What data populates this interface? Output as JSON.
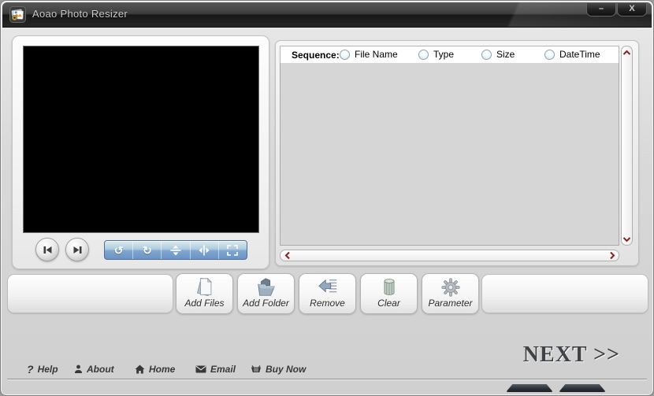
{
  "window": {
    "title": "Aoao Photo Resizer",
    "minimize_glyph": "–",
    "close_glyph": "X"
  },
  "preview": {
    "rotate_left_glyph": "↺",
    "rotate_right_glyph": "↻"
  },
  "sequence": {
    "label": "Sequence:",
    "options": [
      {
        "label": "File Name",
        "selected": false
      },
      {
        "label": "Type",
        "selected": false
      },
      {
        "label": "Size",
        "selected": false
      },
      {
        "label": "DateTime",
        "selected": false
      }
    ]
  },
  "list": {
    "items": []
  },
  "toolbar": {
    "buttons": [
      {
        "label": "Add Files",
        "icon": "add-files-icon"
      },
      {
        "label": "Add Folder",
        "icon": "add-folder-icon"
      },
      {
        "label": "Remove",
        "icon": "remove-icon"
      },
      {
        "label": "Clear",
        "icon": "clear-icon"
      },
      {
        "label": "Parameter",
        "icon": "parameter-icon"
      }
    ]
  },
  "footer": {
    "links": [
      {
        "label": "Help",
        "icon": "help-icon",
        "glyph": "?"
      },
      {
        "label": "About",
        "icon": "about-icon"
      },
      {
        "label": "Home",
        "icon": "home-icon"
      },
      {
        "label": "Email",
        "icon": "email-icon"
      },
      {
        "label": "Buy Now",
        "icon": "buy-now-icon"
      }
    ],
    "next_label": "NEXT >>"
  },
  "colors": {
    "titlebar_dark": "#1c1c1c",
    "rotate_bar_blue": "#7ea6cf",
    "scroll_arrow_maroon": "#8a1f1f",
    "list_background": "#d6d6d6",
    "panel_background": "#f5f5f5"
  }
}
